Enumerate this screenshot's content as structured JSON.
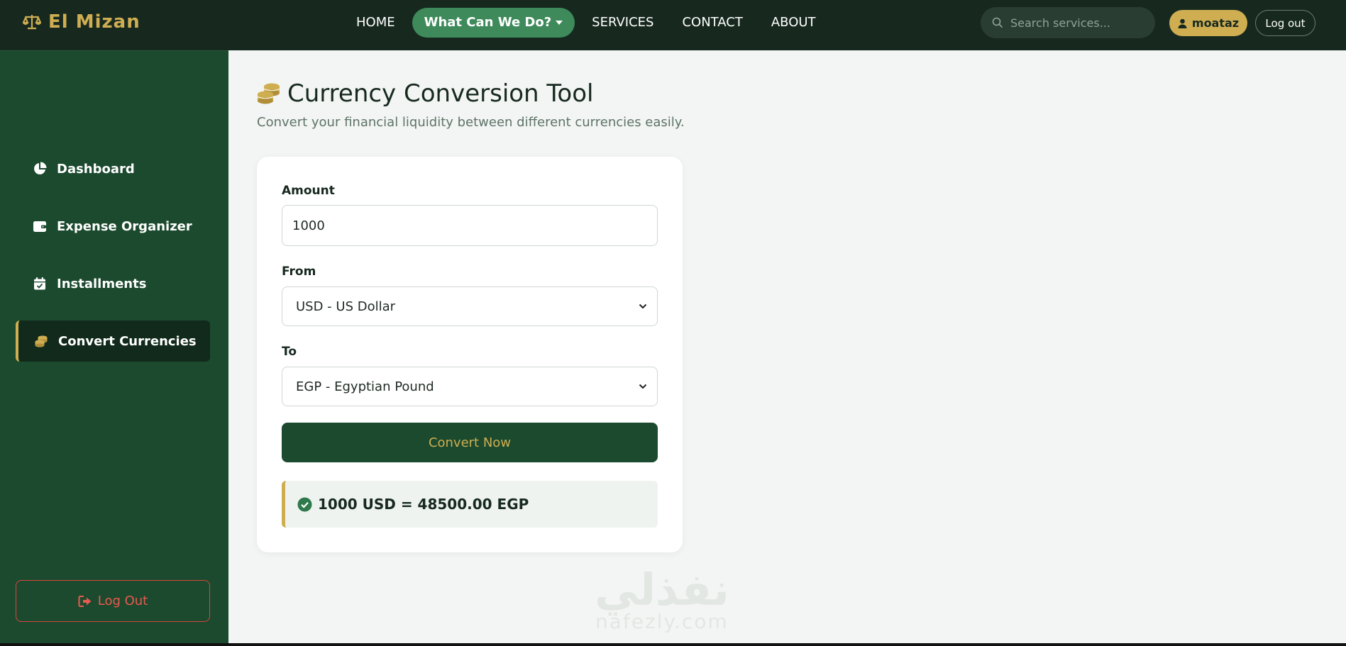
{
  "brand": {
    "name": "El Mizan"
  },
  "nav": {
    "home": "HOME",
    "what": "What Can We Do?",
    "services": "SERVICES",
    "contact": "CONTACT",
    "about": "ABOUT"
  },
  "search": {
    "placeholder": "Search services..."
  },
  "user": {
    "name": "moataz",
    "logout": "Log out"
  },
  "sidebar": {
    "items": [
      {
        "label": "Dashboard",
        "icon": "pie-chart-icon"
      },
      {
        "label": "Expense Organizer",
        "icon": "wallet-icon"
      },
      {
        "label": "Installments",
        "icon": "calendar-check-icon"
      },
      {
        "label": "Convert Currencies",
        "icon": "coins-icon",
        "active": true
      }
    ],
    "logout": "Log Out"
  },
  "page": {
    "title": "Currency Conversion Tool",
    "subtitle": "Convert your financial liquidity between different currencies easily."
  },
  "form": {
    "amount_label": "Amount",
    "amount_value": "1000",
    "from_label": "From",
    "from_value": "USD - US Dollar",
    "to_label": "To",
    "to_value": "EGP - Egyptian Pound",
    "submit": "Convert Now",
    "result": "1000 USD = 48500.00 EGP"
  },
  "watermark": {
    "arabic": "نفذلي",
    "latin": "nafezly.com"
  },
  "colors": {
    "dark": "#17291f",
    "sidebar": "#1b4a2e",
    "gold": "#cfae52",
    "accent_green": "#3e8a5a",
    "danger": "#e85a4f"
  }
}
